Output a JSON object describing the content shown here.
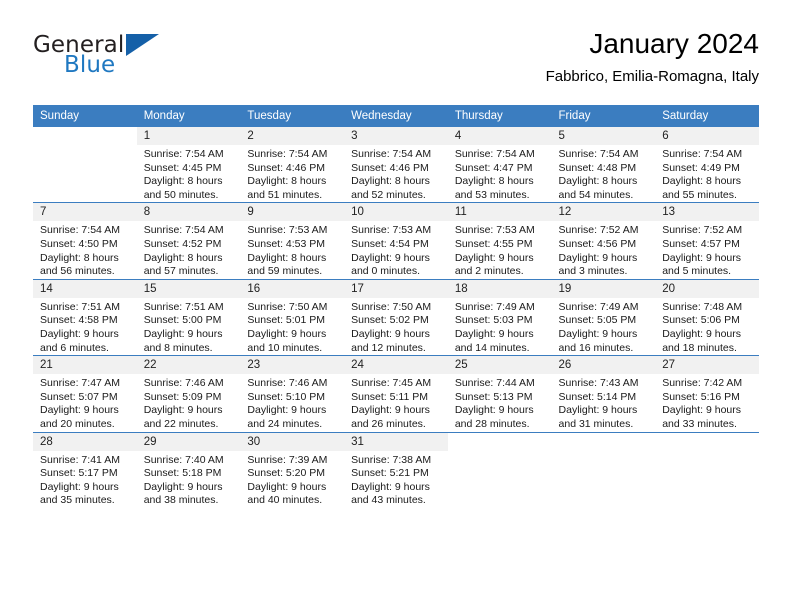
{
  "brand": {
    "name_part1": "General",
    "name_part2": "Blue",
    "triangle_color": "#1560a8",
    "blue_color": "#1f78c1"
  },
  "header": {
    "title": "January 2024",
    "subtitle": "Fabbrico, Emilia-Romagna, Italy",
    "header_bg": "#3b7dc0",
    "date_band_bg": "#f1f1f1"
  },
  "weekday_headers": [
    "Sunday",
    "Monday",
    "Tuesday",
    "Wednesday",
    "Thursday",
    "Friday",
    "Saturday"
  ],
  "weeks": [
    [
      {
        "day": "",
        "sunrise": "",
        "sunset": "",
        "daylight_line1": "",
        "daylight_line2": ""
      },
      {
        "day": "1",
        "sunrise": "Sunrise: 7:54 AM",
        "sunset": "Sunset: 4:45 PM",
        "daylight_line1": "Daylight: 8 hours",
        "daylight_line2": "and 50 minutes."
      },
      {
        "day": "2",
        "sunrise": "Sunrise: 7:54 AM",
        "sunset": "Sunset: 4:46 PM",
        "daylight_line1": "Daylight: 8 hours",
        "daylight_line2": "and 51 minutes."
      },
      {
        "day": "3",
        "sunrise": "Sunrise: 7:54 AM",
        "sunset": "Sunset: 4:46 PM",
        "daylight_line1": "Daylight: 8 hours",
        "daylight_line2": "and 52 minutes."
      },
      {
        "day": "4",
        "sunrise": "Sunrise: 7:54 AM",
        "sunset": "Sunset: 4:47 PM",
        "daylight_line1": "Daylight: 8 hours",
        "daylight_line2": "and 53 minutes."
      },
      {
        "day": "5",
        "sunrise": "Sunrise: 7:54 AM",
        "sunset": "Sunset: 4:48 PM",
        "daylight_line1": "Daylight: 8 hours",
        "daylight_line2": "and 54 minutes."
      },
      {
        "day": "6",
        "sunrise": "Sunrise: 7:54 AM",
        "sunset": "Sunset: 4:49 PM",
        "daylight_line1": "Daylight: 8 hours",
        "daylight_line2": "and 55 minutes."
      }
    ],
    [
      {
        "day": "7",
        "sunrise": "Sunrise: 7:54 AM",
        "sunset": "Sunset: 4:50 PM",
        "daylight_line1": "Daylight: 8 hours",
        "daylight_line2": "and 56 minutes."
      },
      {
        "day": "8",
        "sunrise": "Sunrise: 7:54 AM",
        "sunset": "Sunset: 4:52 PM",
        "daylight_line1": "Daylight: 8 hours",
        "daylight_line2": "and 57 minutes."
      },
      {
        "day": "9",
        "sunrise": "Sunrise: 7:53 AM",
        "sunset": "Sunset: 4:53 PM",
        "daylight_line1": "Daylight: 8 hours",
        "daylight_line2": "and 59 minutes."
      },
      {
        "day": "10",
        "sunrise": "Sunrise: 7:53 AM",
        "sunset": "Sunset: 4:54 PM",
        "daylight_line1": "Daylight: 9 hours",
        "daylight_line2": "and 0 minutes."
      },
      {
        "day": "11",
        "sunrise": "Sunrise: 7:53 AM",
        "sunset": "Sunset: 4:55 PM",
        "daylight_line1": "Daylight: 9 hours",
        "daylight_line2": "and 2 minutes."
      },
      {
        "day": "12",
        "sunrise": "Sunrise: 7:52 AM",
        "sunset": "Sunset: 4:56 PM",
        "daylight_line1": "Daylight: 9 hours",
        "daylight_line2": "and 3 minutes."
      },
      {
        "day": "13",
        "sunrise": "Sunrise: 7:52 AM",
        "sunset": "Sunset: 4:57 PM",
        "daylight_line1": "Daylight: 9 hours",
        "daylight_line2": "and 5 minutes."
      }
    ],
    [
      {
        "day": "14",
        "sunrise": "Sunrise: 7:51 AM",
        "sunset": "Sunset: 4:58 PM",
        "daylight_line1": "Daylight: 9 hours",
        "daylight_line2": "and 6 minutes."
      },
      {
        "day": "15",
        "sunrise": "Sunrise: 7:51 AM",
        "sunset": "Sunset: 5:00 PM",
        "daylight_line1": "Daylight: 9 hours",
        "daylight_line2": "and 8 minutes."
      },
      {
        "day": "16",
        "sunrise": "Sunrise: 7:50 AM",
        "sunset": "Sunset: 5:01 PM",
        "daylight_line1": "Daylight: 9 hours",
        "daylight_line2": "and 10 minutes."
      },
      {
        "day": "17",
        "sunrise": "Sunrise: 7:50 AM",
        "sunset": "Sunset: 5:02 PM",
        "daylight_line1": "Daylight: 9 hours",
        "daylight_line2": "and 12 minutes."
      },
      {
        "day": "18",
        "sunrise": "Sunrise: 7:49 AM",
        "sunset": "Sunset: 5:03 PM",
        "daylight_line1": "Daylight: 9 hours",
        "daylight_line2": "and 14 minutes."
      },
      {
        "day": "19",
        "sunrise": "Sunrise: 7:49 AM",
        "sunset": "Sunset: 5:05 PM",
        "daylight_line1": "Daylight: 9 hours",
        "daylight_line2": "and 16 minutes."
      },
      {
        "day": "20",
        "sunrise": "Sunrise: 7:48 AM",
        "sunset": "Sunset: 5:06 PM",
        "daylight_line1": "Daylight: 9 hours",
        "daylight_line2": "and 18 minutes."
      }
    ],
    [
      {
        "day": "21",
        "sunrise": "Sunrise: 7:47 AM",
        "sunset": "Sunset: 5:07 PM",
        "daylight_line1": "Daylight: 9 hours",
        "daylight_line2": "and 20 minutes."
      },
      {
        "day": "22",
        "sunrise": "Sunrise: 7:46 AM",
        "sunset": "Sunset: 5:09 PM",
        "daylight_line1": "Daylight: 9 hours",
        "daylight_line2": "and 22 minutes."
      },
      {
        "day": "23",
        "sunrise": "Sunrise: 7:46 AM",
        "sunset": "Sunset: 5:10 PM",
        "daylight_line1": "Daylight: 9 hours",
        "daylight_line2": "and 24 minutes."
      },
      {
        "day": "24",
        "sunrise": "Sunrise: 7:45 AM",
        "sunset": "Sunset: 5:11 PM",
        "daylight_line1": "Daylight: 9 hours",
        "daylight_line2": "and 26 minutes."
      },
      {
        "day": "25",
        "sunrise": "Sunrise: 7:44 AM",
        "sunset": "Sunset: 5:13 PM",
        "daylight_line1": "Daylight: 9 hours",
        "daylight_line2": "and 28 minutes."
      },
      {
        "day": "26",
        "sunrise": "Sunrise: 7:43 AM",
        "sunset": "Sunset: 5:14 PM",
        "daylight_line1": "Daylight: 9 hours",
        "daylight_line2": "and 31 minutes."
      },
      {
        "day": "27",
        "sunrise": "Sunrise: 7:42 AM",
        "sunset": "Sunset: 5:16 PM",
        "daylight_line1": "Daylight: 9 hours",
        "daylight_line2": "and 33 minutes."
      }
    ],
    [
      {
        "day": "28",
        "sunrise": "Sunrise: 7:41 AM",
        "sunset": "Sunset: 5:17 PM",
        "daylight_line1": "Daylight: 9 hours",
        "daylight_line2": "and 35 minutes."
      },
      {
        "day": "29",
        "sunrise": "Sunrise: 7:40 AM",
        "sunset": "Sunset: 5:18 PM",
        "daylight_line1": "Daylight: 9 hours",
        "daylight_line2": "and 38 minutes."
      },
      {
        "day": "30",
        "sunrise": "Sunrise: 7:39 AM",
        "sunset": "Sunset: 5:20 PM",
        "daylight_line1": "Daylight: 9 hours",
        "daylight_line2": "and 40 minutes."
      },
      {
        "day": "31",
        "sunrise": "Sunrise: 7:38 AM",
        "sunset": "Sunset: 5:21 PM",
        "daylight_line1": "Daylight: 9 hours",
        "daylight_line2": "and 43 minutes."
      },
      {
        "day": "",
        "sunrise": "",
        "sunset": "",
        "daylight_line1": "",
        "daylight_line2": ""
      },
      {
        "day": "",
        "sunrise": "",
        "sunset": "",
        "daylight_line1": "",
        "daylight_line2": ""
      },
      {
        "day": "",
        "sunrise": "",
        "sunset": "",
        "daylight_line1": "",
        "daylight_line2": ""
      }
    ]
  ]
}
